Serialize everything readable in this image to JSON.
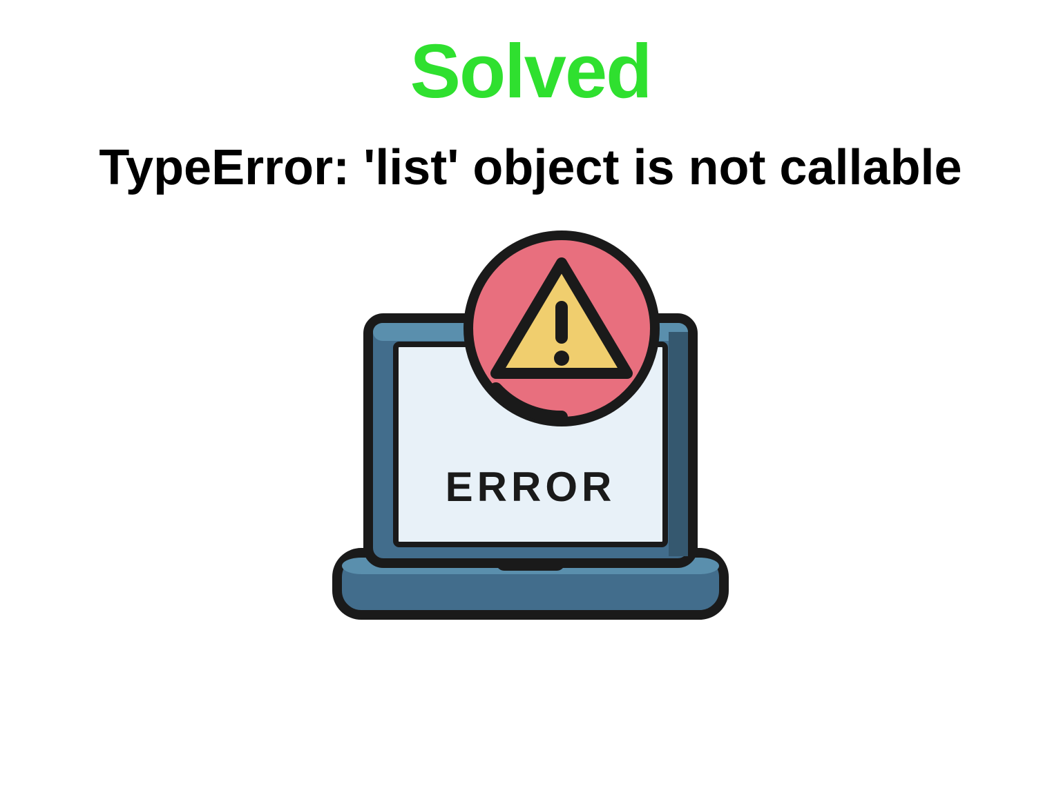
{
  "heading": {
    "solved": "Solved",
    "error_title": "TypeError: 'list' object is not callable"
  },
  "laptop": {
    "screen_text": "ERROR"
  },
  "colors": {
    "solved_green": "#2fe02f",
    "black": "#000000",
    "laptop_blue": "#426d8c",
    "laptop_top": "#5a8fad",
    "badge_pink": "#e86f7e",
    "triangle_yellow": "#f0ce6e",
    "outline_dark": "#1a1a1a",
    "screen_light": "#e8f1f8"
  }
}
